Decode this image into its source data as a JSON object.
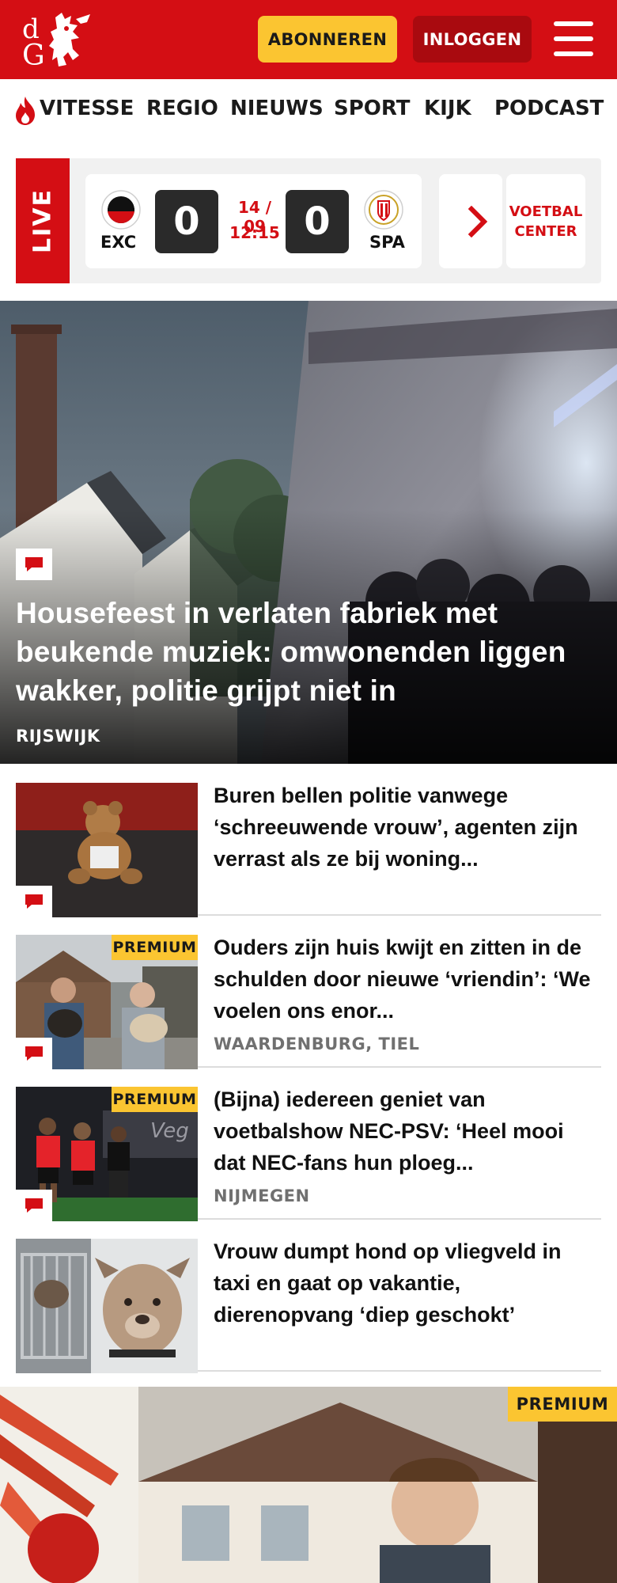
{
  "header": {
    "logo_text": "dG",
    "subscribe_label": "ABONNEREN",
    "login_label": "INLOGGEN",
    "menu_icon": "hamburger-menu-icon",
    "brand_color": "#d40e14"
  },
  "nav": {
    "items": [
      {
        "label": "VITESSE",
        "icon": "flame-icon"
      },
      {
        "label": "REGIO"
      },
      {
        "label": "NIEUWS"
      },
      {
        "label": "SPORT"
      },
      {
        "label": "KIJK"
      },
      {
        "label": "PODCAST"
      }
    ]
  },
  "live": {
    "label": "LIVE",
    "match": {
      "home_abbr": "EXC",
      "away_abbr": "SPA",
      "home_score": "0",
      "away_score": "0",
      "date": "14 / 09",
      "time": "12:15"
    },
    "voetbal_center_label": "VOETBAL CENTER"
  },
  "hero": {
    "title": "Housefeest in verlaten fabriek met beukende muziek: omwonenden liggen wakker, politie grijpt niet in",
    "location": "RIJSWIJK",
    "has_comments": true
  },
  "articles": [
    {
      "title": "Buren bellen politie vanwege ‘schreeuwende vrouw’, agenten zijn verrast als ze bij woning...",
      "location": "",
      "premium": false,
      "has_comments": true
    },
    {
      "title": "Ouders zijn huis kwijt en zitten in de schulden door nieuwe ‘vriendin’: ‘We voelen ons enor...",
      "location": "WAARDENBURG, TIEL",
      "premium": true,
      "premium_label": "PREMIUM",
      "has_comments": true
    },
    {
      "title": "(Bijna) iedereen geniet van voetbalshow NEC-PSV: ‘Heel mooi dat NEC-fans hun ploeg...",
      "location": "NIJMEGEN",
      "premium": true,
      "premium_label": "PREMIUM",
      "has_comments": true
    },
    {
      "title": "Vrouw dumpt hond op vliegveld in taxi en gaat op vakantie, dierenopvang ‘diep geschokt’",
      "location": "",
      "premium": false,
      "has_comments": false
    }
  ],
  "feature": {
    "premium_label": "PREMIUM"
  }
}
